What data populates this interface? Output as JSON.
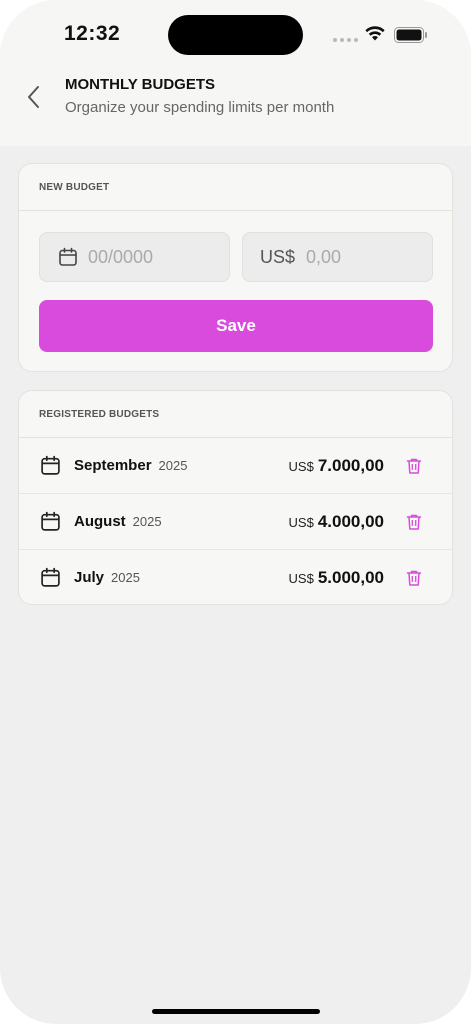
{
  "status_bar": {
    "time": "12:32"
  },
  "header": {
    "title": "MONTHLY BUDGETS",
    "subtitle": "Organize your spending limits per month",
    "back_icon": "chevron-left-icon"
  },
  "new_budget": {
    "section_label": "NEW BUDGET",
    "date_field": {
      "placeholder": "00/0000",
      "value": ""
    },
    "amount_field": {
      "currency": "US$",
      "placeholder": "0,00",
      "value": ""
    },
    "save_label": "Save"
  },
  "registered": {
    "section_label": "REGISTERED BUDGETS",
    "items": [
      {
        "month": "September",
        "year": "2025",
        "currency": "US$",
        "amount": "7.000,00"
      },
      {
        "month": "August",
        "year": "2025",
        "currency": "US$",
        "amount": "4.000,00"
      },
      {
        "month": "July",
        "year": "2025",
        "currency": "US$",
        "amount": "5.000,00"
      }
    ]
  },
  "colors": {
    "accent": "#d84bdc",
    "header_bg": "#f6f7f4",
    "page_bg": "#efefef"
  }
}
